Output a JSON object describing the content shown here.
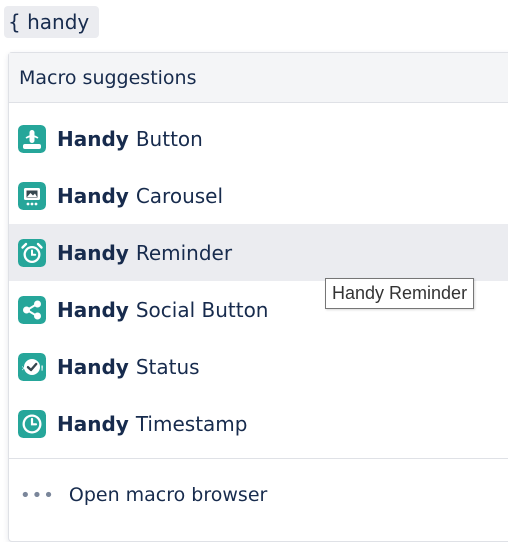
{
  "editor": {
    "query_text": "{ handy"
  },
  "dropdown": {
    "header": "Macro suggestions",
    "items": [
      {
        "bold": "Handy",
        "rest": "Button",
        "icon": "touch-button-icon",
        "color": "#26a69a"
      },
      {
        "bold": "Handy",
        "rest": "Carousel",
        "icon": "carousel-icon",
        "color": "#26a69a"
      },
      {
        "bold": "Handy",
        "rest": "Reminder",
        "icon": "alarm-clock-icon",
        "color": "#26a69a",
        "highlighted": true
      },
      {
        "bold": "Handy",
        "rest": "Social Button",
        "icon": "share-icon",
        "color": "#26a69a"
      },
      {
        "bold": "Handy",
        "rest": "Status",
        "icon": "status-check-icon",
        "color": "#26a69a"
      },
      {
        "bold": "Handy",
        "rest": "Timestamp",
        "icon": "clock-icon",
        "color": "#26a69a"
      }
    ],
    "browser_link": "Open macro browser",
    "browser_icon": "ellipsis-icon"
  },
  "tooltip": {
    "text": "Handy Reminder"
  },
  "colors": {
    "accent_teal": "#26a69a",
    "highlight_bg": "#ebecf0",
    "text": "#172b4d"
  }
}
